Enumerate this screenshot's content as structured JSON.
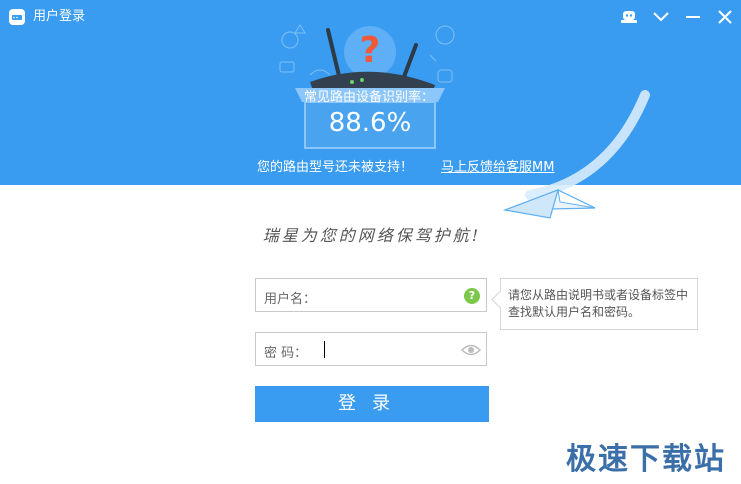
{
  "window": {
    "title": "用户登录"
  },
  "titlebar": {
    "icons": [
      "skin-icon",
      "chevron-down-icon",
      "minimize-icon",
      "close-icon"
    ]
  },
  "banner": {
    "recognition_label": "常见路由设备识别率：",
    "recognition_rate": "88.6%",
    "notice": "您的路由型号还未被支持！",
    "feedback_link": "马上反馈给客服MM"
  },
  "slogan": "瑞星为您的网络保驾护航!",
  "form": {
    "username_label": "用户名：",
    "username_value": "",
    "password_label": "密 码：",
    "password_value": "",
    "tooltip": "请您从路由说明书或者设备标签中查找默认用户名和密码。",
    "login_label": "登录"
  },
  "watermark": "极速下载站",
  "colors": {
    "accent": "#3a9cf0",
    "help": "#7cc64a"
  }
}
